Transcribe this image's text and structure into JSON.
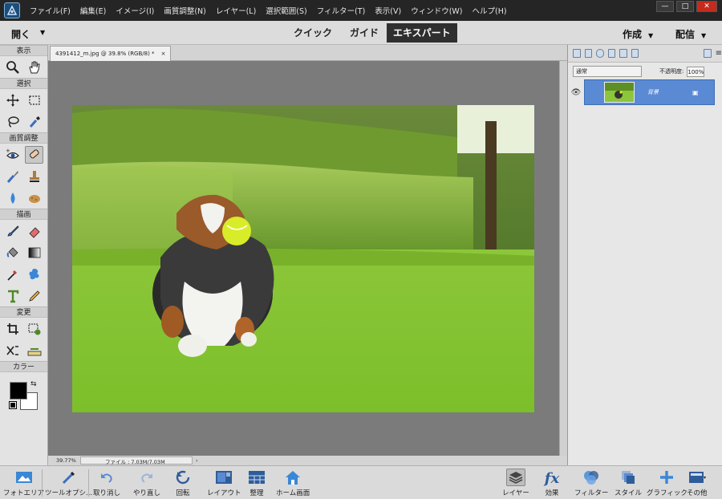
{
  "menubar": {
    "items": [
      "ファイル(F)",
      "編集(E)",
      "イメージ(I)",
      "画質調整(N)",
      "レイヤー(L)",
      "選択範囲(S)",
      "フィルター(T)",
      "表示(V)",
      "ウィンドウ(W)",
      "ヘルプ(H)"
    ],
    "window_controls": [
      "minimize",
      "maximize",
      "close"
    ]
  },
  "modebar": {
    "open_label": "開く",
    "tabs": [
      "クイック",
      "ガイド",
      "エキスパート"
    ],
    "active_tab": "エキスパート",
    "create_label": "作成",
    "share_label": "配信"
  },
  "toolbox": {
    "sections": [
      {
        "header": "表示",
        "tools": [
          "zoom-tool-icon",
          "hand-tool-icon"
        ]
      },
      {
        "header": "選択",
        "tools": [
          "move-tool-icon",
          "marquee-tool-icon",
          "lasso-tool-icon",
          "quick-selection-tool-icon"
        ]
      },
      {
        "header": "画質調整",
        "tools": [
          "red-eye-tool-icon",
          "spot-healing-brush-icon",
          "smart-brush-icon",
          "clone-stamp-icon",
          "blur-tool-icon",
          "sponge-tool-icon"
        ]
      },
      {
        "header": "描画",
        "tools": [
          "brush-tool-icon",
          "eraser-tool-icon",
          "paint-bucket-icon",
          "gradient-tool-icon",
          "eyedropper-icon",
          "custom-shape-icon",
          "type-tool-icon",
          "pencil-tool-icon"
        ]
      },
      {
        "header": "変更",
        "tools": [
          "crop-tool-icon",
          "recompose-tool-icon",
          "content-aware-move-icon",
          "straighten-tool-icon"
        ]
      },
      {
        "header": "カラー",
        "tools": []
      }
    ],
    "selected_tool": "spot-healing-brush-icon",
    "foreground_color": "#000000",
    "background_color": "#ffffff"
  },
  "document": {
    "tab_title": "4391412_m.jpg @ 39.8% (RGB/8) *",
    "close_glyph": "×",
    "zoom": "39.77%",
    "file_info": "ファイル : 7.03M/7.03M"
  },
  "layers": {
    "blend_mode": "通常",
    "opacity_label": "不透明度:",
    "opacity_value": "100%",
    "layer_name": "背景"
  },
  "taskbar": {
    "items": [
      {
        "icon": "photo-bin-icon",
        "label": "フォトエリア"
      },
      {
        "icon": "tool-options-icon",
        "label": "ツールオプシ..."
      },
      {
        "icon": "undo-icon",
        "label": "取り消し"
      },
      {
        "icon": "redo-icon",
        "label": "やり直し"
      },
      {
        "icon": "rotate-icon",
        "label": "回転"
      },
      {
        "icon": "layout-icon",
        "label": "レイアウト"
      },
      {
        "icon": "organizer-icon",
        "label": "整理"
      },
      {
        "icon": "home-screen-icon",
        "label": "ホーム画面"
      },
      {
        "icon": "layers-icon",
        "label": "レイヤー"
      },
      {
        "icon": "effects-icon",
        "label": "効果"
      },
      {
        "icon": "filters-icon",
        "label": "フィルター"
      },
      {
        "icon": "styles-icon",
        "label": "スタイル"
      },
      {
        "icon": "graphics-icon",
        "label": "グラフィック"
      },
      {
        "icon": "more-icon",
        "label": "その他"
      }
    ],
    "selected": "レイヤー"
  },
  "colors": {
    "menubar_bg": "#252525",
    "modebar_bg": "#dcdcdc",
    "active_tab_bg": "#2f2f2f",
    "canvas_bg": "#7b7b7b",
    "layer_selected_bg": "#5a8ad3"
  }
}
